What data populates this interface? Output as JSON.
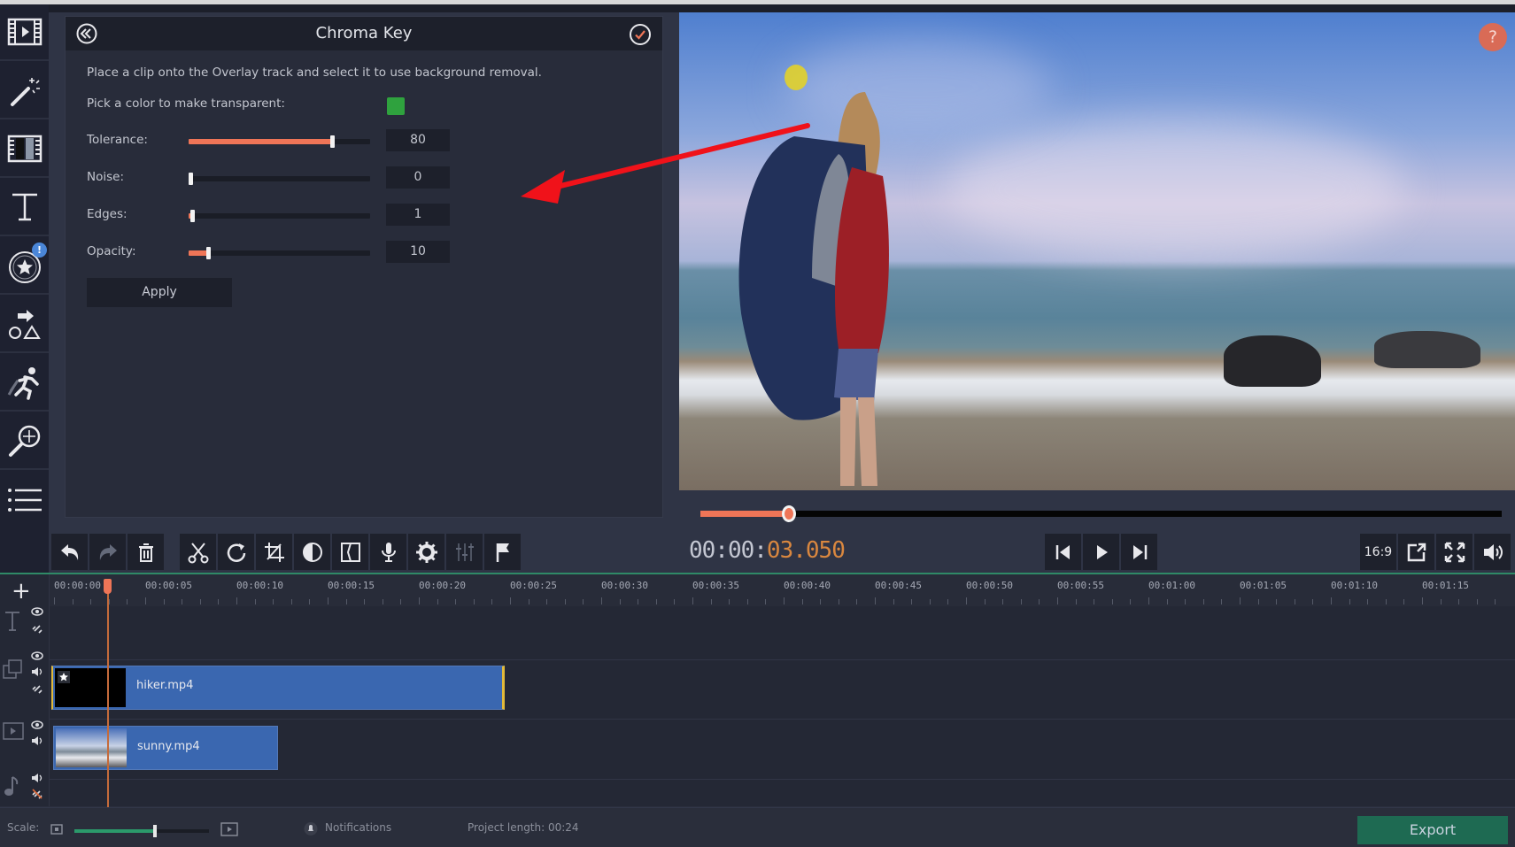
{
  "sidebar": {
    "items": [
      {
        "name": "import-media",
        "icon": "film-play-icon"
      },
      {
        "name": "filters",
        "icon": "magic-wand-icon"
      },
      {
        "name": "transitions",
        "icon": "film-transition-icon"
      },
      {
        "name": "titles",
        "icon": "text-icon"
      },
      {
        "name": "stickers",
        "icon": "star-circle-icon",
        "badge": "!"
      },
      {
        "name": "callouts",
        "icon": "shapes-icon"
      },
      {
        "name": "animation",
        "icon": "running-man-icon"
      },
      {
        "name": "zoom-pan",
        "icon": "zoom-pan-icon"
      },
      {
        "name": "more-tools",
        "icon": "list-icon"
      }
    ]
  },
  "panel": {
    "title": "Chroma Key",
    "description": "Place a clip onto the Overlay track and select it to use background removal.",
    "pick_label": "Pick a color to make transparent:",
    "pick_color": "#2fa23e",
    "apply_label": "Apply",
    "controls": [
      {
        "label": "Tolerance:",
        "value": "80",
        "fraction": 0.8
      },
      {
        "label": "Noise:",
        "value": "0",
        "fraction": 0.0
      },
      {
        "label": "Edges:",
        "value": "1",
        "fraction": 0.01
      },
      {
        "label": "Opacity:",
        "value": "10",
        "fraction": 0.1
      }
    ]
  },
  "preview": {
    "help_label": "?",
    "seek_fraction": 0.111
  },
  "toolbar": {
    "timecode_main": "00:00:",
    "timecode_accent": "03.050",
    "aspect_label": "16:9"
  },
  "timeline": {
    "ticks": [
      "00:00:00",
      "00:00:05",
      "00:00:10",
      "00:00:15",
      "00:00:20",
      "00:00:25",
      "00:00:30",
      "00:00:35",
      "00:00:40",
      "00:00:45",
      "00:00:50",
      "00:00:55",
      "00:01:00",
      "00:01:05",
      "00:01:10",
      "00:01:15"
    ],
    "clips": {
      "overlay": "hiker.mp4",
      "main": "sunny.mp4"
    }
  },
  "status": {
    "scale_label": "Scale:",
    "scale_fraction": 0.6,
    "notifications_label": "Notifications",
    "project_length": "Project length:  00:24",
    "export_label": "Export"
  },
  "colors": {
    "accent": "#ef7557",
    "export_green": "#1e6a52",
    "clip_blue": "#3a67b0",
    "timecode_orange": "#d9873f"
  }
}
